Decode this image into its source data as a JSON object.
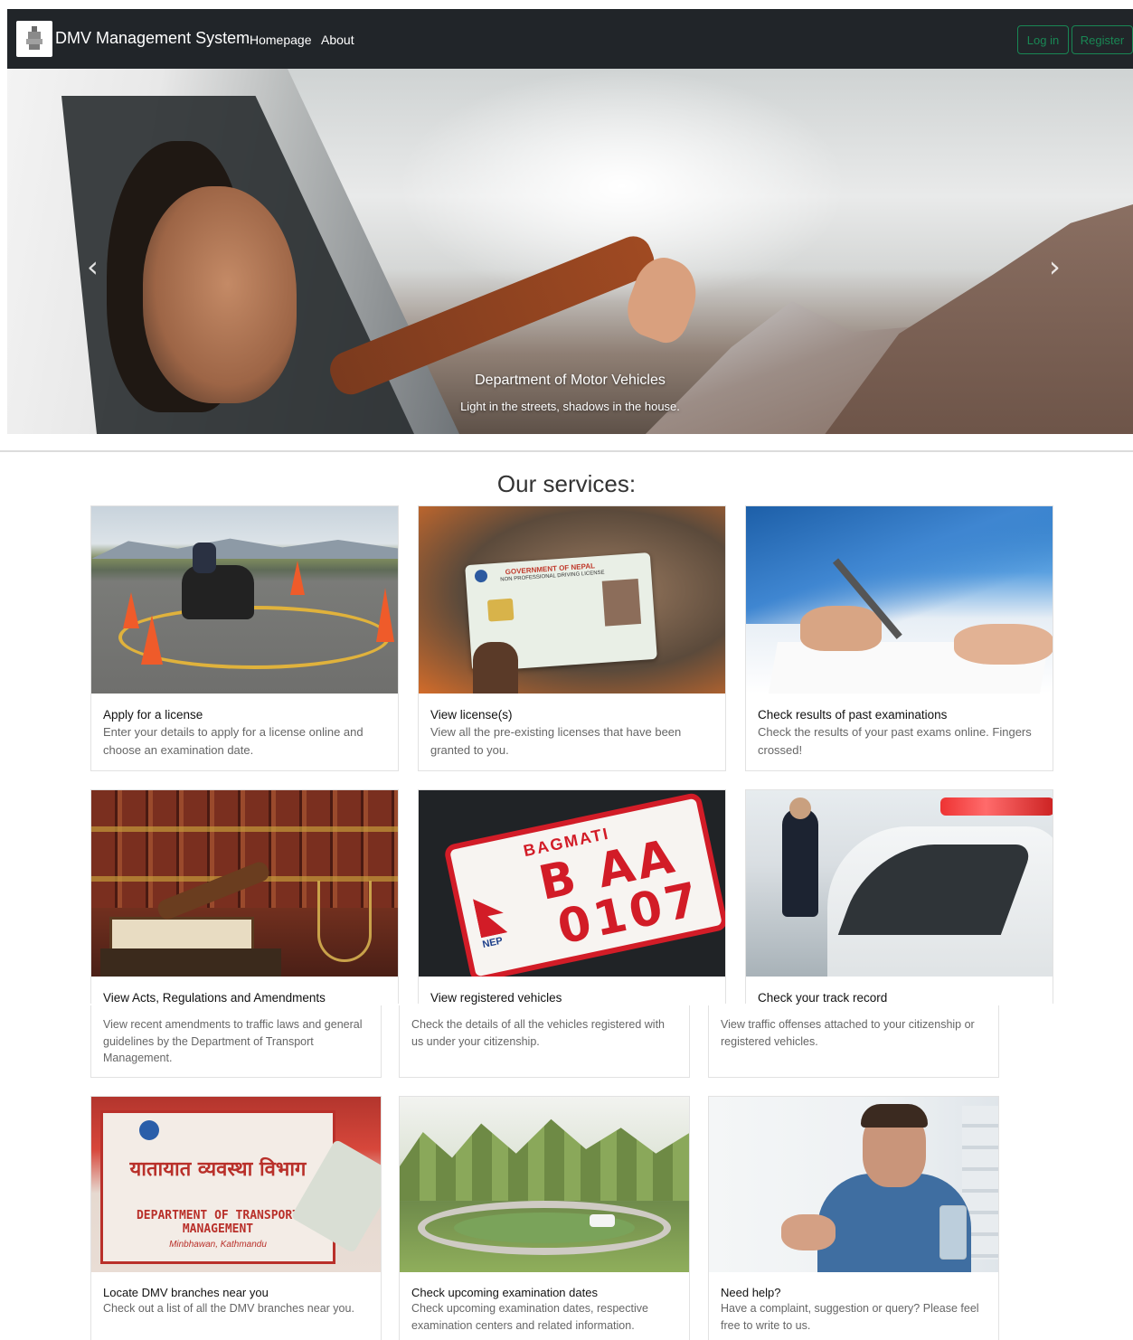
{
  "navbar": {
    "brand": "DMV Management System",
    "links": [
      "Homepage",
      "About"
    ],
    "login": "Log in",
    "register": "Register",
    "colors": {
      "background": "#212529",
      "accent": "#198754"
    }
  },
  "hero": {
    "title": "Department of Motor Vehicles",
    "subtitle": "Light in the streets, shadows in the house.",
    "prev_icon": "chevron-left-icon",
    "next_icon": "chevron-right-icon"
  },
  "services": {
    "heading": "Our services:",
    "cards": [
      {
        "title": "Apply for a license",
        "text": "Enter your details to apply for a license online and choose an examination date."
      },
      {
        "title": "View license(s)",
        "text": "View all the pre-existing licenses that have been granted to you."
      },
      {
        "title": "Check results of past examinations",
        "text": "Check the results of your past exams online. Fingers crossed!"
      },
      {
        "title": "View Acts, Regulations and Amendments",
        "text": "View recent amendments to traffic laws and general guidelines by the Department of Transport Management."
      },
      {
        "title": "View registered vehicles",
        "text": "Check the details of all the vehicles registered with us under your citizenship."
      },
      {
        "title": "Check your track record",
        "text": "View traffic offenses attached to your citizenship or registered vehicles."
      },
      {
        "title": "Locate DMV branches near you",
        "text": "Check out a list of all the DMV branches near you."
      },
      {
        "title": "Check upcoming examination dates",
        "text": "Check upcoming examination dates, respective examination centers and related information."
      },
      {
        "title": "Need help?",
        "text": "Have a complaint, suggestion or query? Please feel free to write to us."
      }
    ]
  },
  "image_text": {
    "license_card": {
      "header": "GOVERNMENT OF NEPAL",
      "subheader": "NON PROFESSIONAL DRIVING LICENSE"
    },
    "plate": {
      "region": "BAGMATI",
      "line1": "B AA",
      "line2": "0107",
      "country": "NEP"
    },
    "dotm_sign": {
      "line1": "यातायात व्यवस्था विभाग",
      "line2": "DEPARTMENT OF TRANSPORT MANAGEMENT",
      "line3": "Minbhawan, Kathmandu"
    }
  }
}
